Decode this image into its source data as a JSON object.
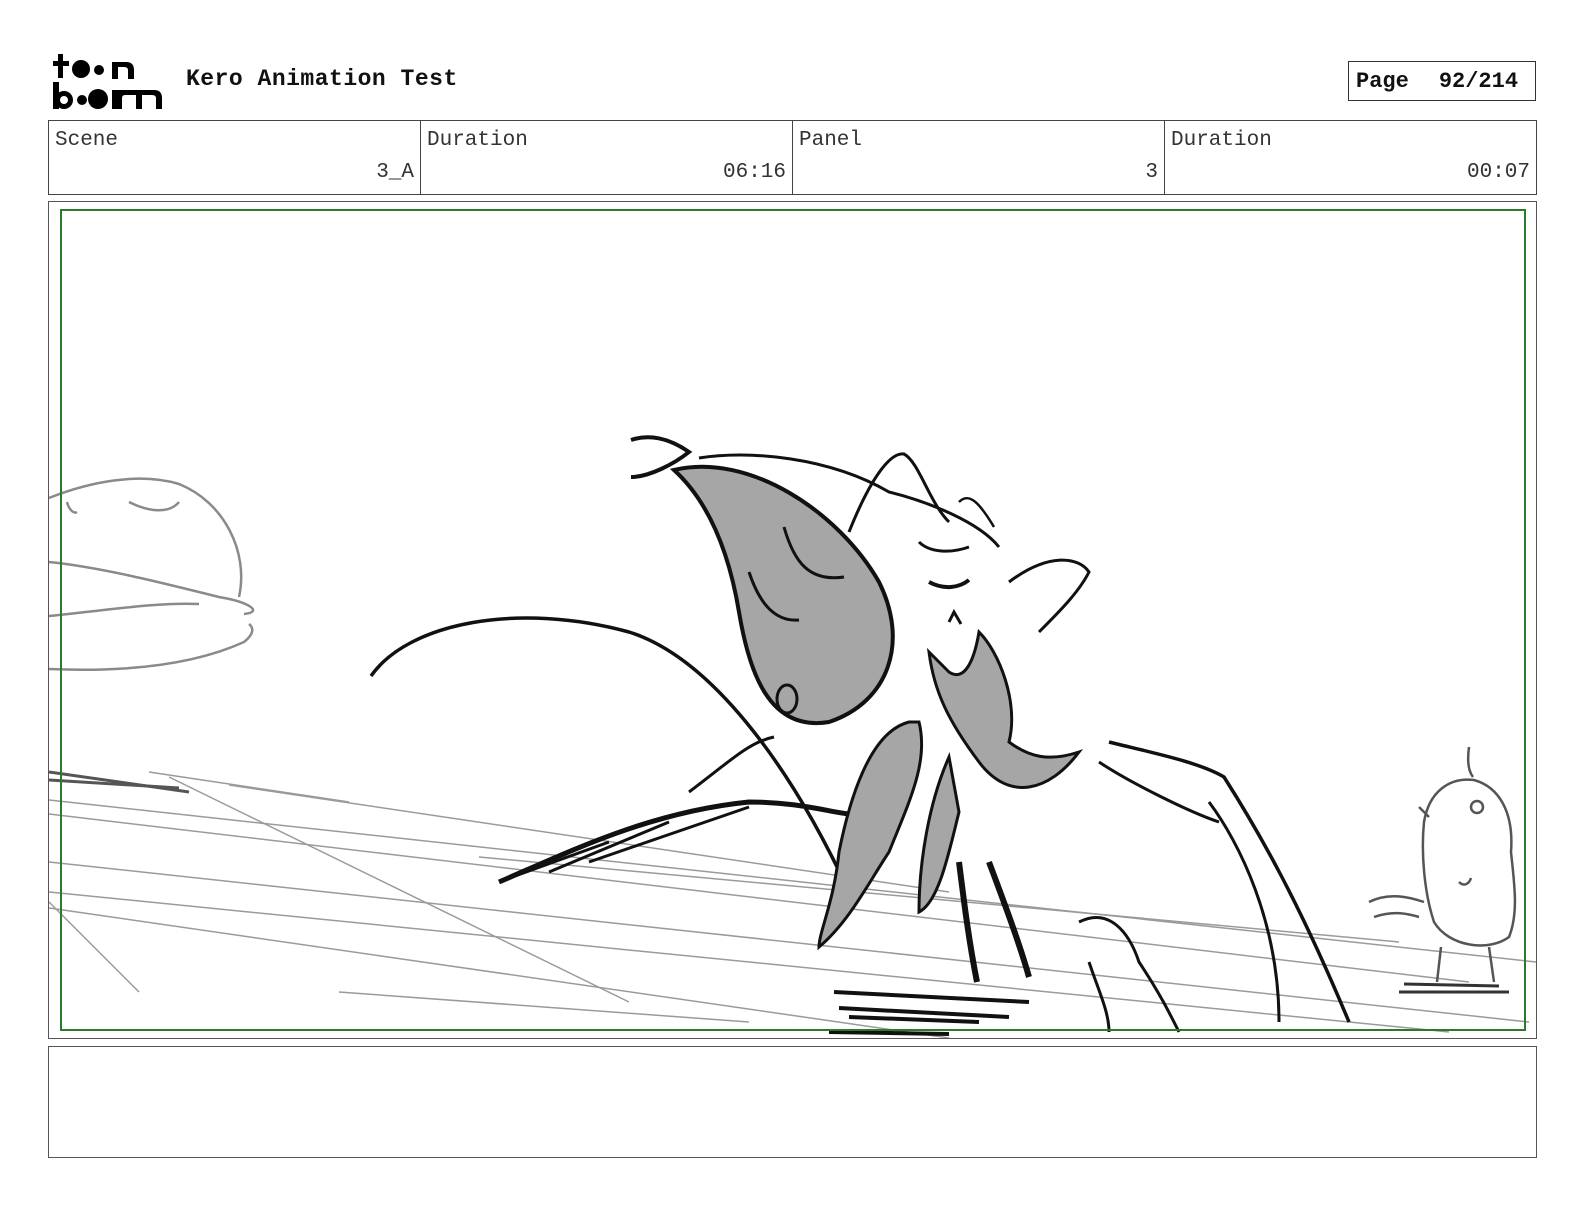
{
  "header": {
    "logo_text": "toon boom",
    "project_title": "Kero Animation Test",
    "page_label": "Page",
    "page_value": "92/214"
  },
  "info": {
    "scene_label": "Scene",
    "scene_value": "3_A",
    "duration_label": "Duration",
    "duration_value": "06:16",
    "panel_label": "Panel",
    "panel_value": "3",
    "panel_duration_label": "Duration",
    "panel_duration_value": "00:07"
  },
  "notes": {
    "text": ""
  },
  "colors": {
    "safe_frame": "#2c7a2c",
    "sketch_line": "#111111",
    "sketch_fill": "#a6a6a6",
    "light_line": "#9a9a9a"
  }
}
